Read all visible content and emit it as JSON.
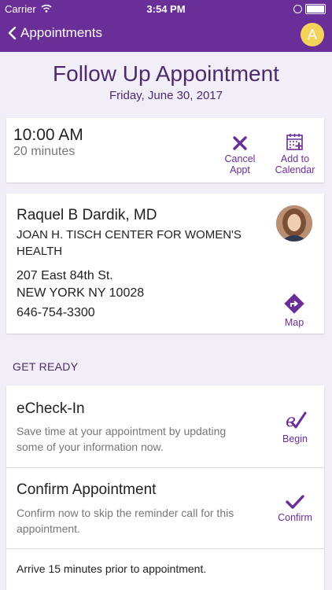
{
  "status_bar": {
    "carrier": "Carrier",
    "time": "3:54 PM"
  },
  "nav": {
    "back_label": "Appointments",
    "avatar_initial": "A"
  },
  "header": {
    "title": "Follow Up Appointment",
    "date": "Friday, June 30, 2017"
  },
  "appointment": {
    "time": "10:00 AM",
    "duration": "20 minutes",
    "cancel_line1": "Cancel",
    "cancel_line2": "Appt",
    "calendar_line1": "Add to",
    "calendar_line2": "Calendar"
  },
  "provider": {
    "name": "Raquel B Dardik, MD",
    "location_line1": "JOAN H. TISCH CENTER FOR WOMEN'S",
    "location_line2": "HEALTH",
    "address_line1": "207 East 84th St.",
    "address_line2": "NEW YORK NY 10028",
    "phone": "646-754-3300",
    "map_label": "Map"
  },
  "get_ready": {
    "section_title": "GET READY",
    "echeckin": {
      "title": "eCheck-In",
      "desc_line1": "Save time at your appointment by updating",
      "desc_line2": "some of your information now.",
      "action": "Begin"
    },
    "confirm": {
      "title": "Confirm Appointment",
      "desc_line1": "Confirm now to skip the reminder call for this",
      "desc_line2": "appointment.",
      "action": "Confirm"
    },
    "arrive_note": "Arrive 15 minutes prior to appointment."
  },
  "colors": {
    "brand_purple": "#6a2e98",
    "accent_yellow": "#f3d35a",
    "background": "#f1eef7"
  }
}
